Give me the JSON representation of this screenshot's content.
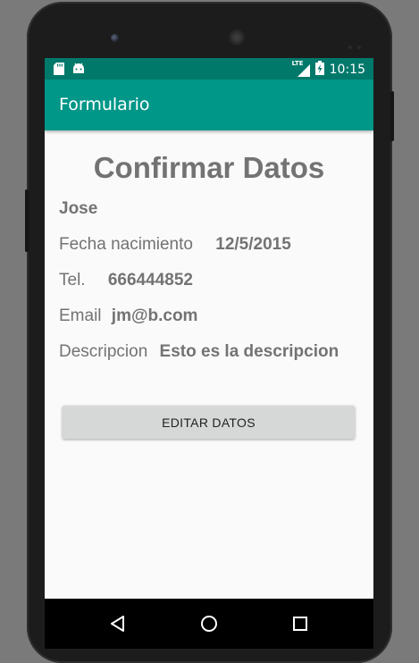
{
  "colors": {
    "status_bar": "#00796b",
    "app_bar": "#009688",
    "text": "#737373",
    "button_bg": "#d6d7d7",
    "nav_bar": "#000000"
  },
  "status_bar": {
    "icons_left": [
      "sd-card-icon",
      "android-icon"
    ],
    "network_label": "LTE",
    "icons_right": [
      "signal-icon",
      "battery-charging-icon"
    ],
    "time": "10:15"
  },
  "app_bar": {
    "title": "Formulario"
  },
  "main": {
    "title": "Confirmar Datos",
    "name": "Jose",
    "birth_label": "Fecha nacimiento",
    "birth_value": "12/5/2015",
    "phone_label": "Tel.",
    "phone_value": "666444852",
    "email_label": "Email",
    "email_value": "jm@b.com",
    "desc_label": "Descripcion",
    "desc_value": "Esto es la descripcion",
    "edit_button": "EDITAR DATOS"
  },
  "nav_bar": {
    "buttons": [
      "back-icon",
      "home-icon",
      "recents-icon"
    ]
  }
}
